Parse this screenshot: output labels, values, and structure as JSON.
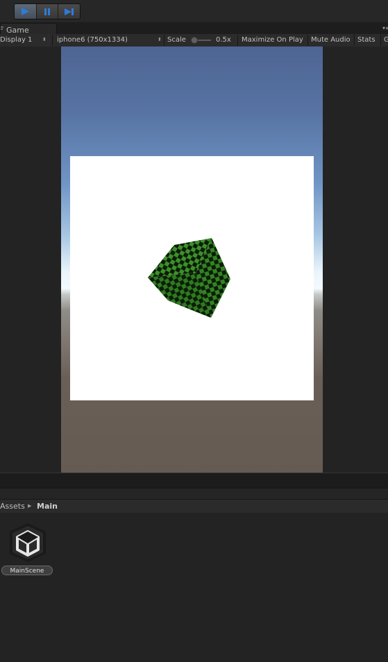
{
  "toolbar": {
    "play_icon": "play-icon",
    "pause_icon": "pause-icon",
    "step_icon": "step-icon",
    "accent": "#2f7bd9"
  },
  "game_tab": {
    "label": "Game",
    "icon": "game-controller-icon",
    "menu_glyph": "▾≡"
  },
  "game_toolbar": {
    "display": "Display 1",
    "resolution": "iphone6 (750x1334)",
    "scale_label": "Scale",
    "scale_value": "0.5x",
    "maximize_on_play": "Maximize On Play",
    "mute_audio": "Mute Audio",
    "stats": "Stats",
    "gizmos_partial": "G"
  },
  "project": {
    "breadcrumb": [
      "Assets",
      "Main"
    ],
    "assets": [
      {
        "name": "MainScene",
        "icon": "unity-scene-icon"
      }
    ]
  },
  "scene_colors": {
    "sky_top": "#4e6592",
    "horizon": "#f4fafd",
    "ground": "#655b53",
    "panel": "#ffffff",
    "checker_light": "#3d8f2b",
    "checker_dark": "#0b1e07"
  }
}
